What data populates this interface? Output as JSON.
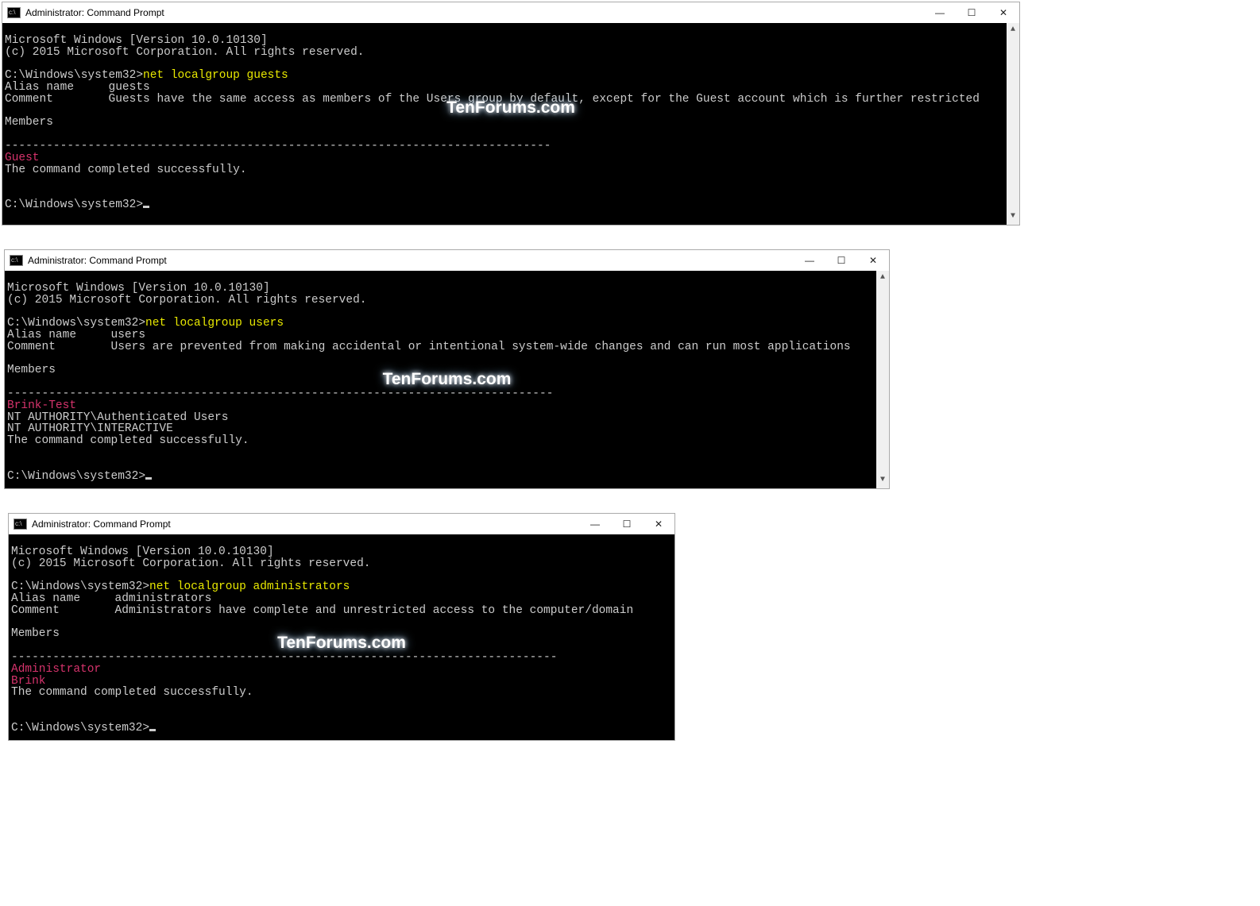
{
  "windows": [
    {
      "title": "Administrator: Command Prompt",
      "watermark": "TenForums.com",
      "header1": "Microsoft Windows [Version 10.0.10130]",
      "header2": "(c) 2015 Microsoft Corporation. All rights reserved.",
      "prompt_path": "C:\\Windows\\system32>",
      "command": "net localgroup guests",
      "alias_label": "Alias name",
      "alias_value": "guests",
      "comment_label": "Comment",
      "comment_value": "Guests have the same access as members of the Users group by default, except for the Guest account which is further restricted",
      "members_label": "Members",
      "divider": "-------------------------------------------------------------------------------",
      "member1": "Guest",
      "success": "The command completed successfully.",
      "prompt2": "C:\\Windows\\system32>"
    },
    {
      "title": "Administrator: Command Prompt",
      "watermark": "TenForums.com",
      "header1": "Microsoft Windows [Version 10.0.10130]",
      "header2": "(c) 2015 Microsoft Corporation. All rights reserved.",
      "prompt_path": "C:\\Windows\\system32>",
      "command": "net localgroup users",
      "alias_label": "Alias name",
      "alias_value": "users",
      "comment_label": "Comment",
      "comment_value": "Users are prevented from making accidental or intentional system-wide changes and can run most applications",
      "members_label": "Members",
      "divider": "-------------------------------------------------------------------------------",
      "member1": "Brink-Test",
      "member2": "NT AUTHORITY\\Authenticated Users",
      "member3": "NT AUTHORITY\\INTERACTIVE",
      "success": "The command completed successfully.",
      "prompt2": "C:\\Windows\\system32>"
    },
    {
      "title": "Administrator: Command Prompt",
      "watermark": "TenForums.com",
      "header1": "Microsoft Windows [Version 10.0.10130]",
      "header2": "(c) 2015 Microsoft Corporation. All rights reserved.",
      "prompt_path": "C:\\Windows\\system32>",
      "command": "net localgroup administrators",
      "alias_label": "Alias name",
      "alias_value": "administrators",
      "comment_label": "Comment",
      "comment_value": "Administrators have complete and unrestricted access to the computer/domain",
      "members_label": "Members",
      "divider": "-------------------------------------------------------------------------------",
      "member1": "Administrator",
      "member2": "Brink",
      "success": "The command completed successfully.",
      "prompt2": "C:\\Windows\\system32>"
    }
  ],
  "controls": {
    "min": "—",
    "max": "☐",
    "close": "✕"
  }
}
